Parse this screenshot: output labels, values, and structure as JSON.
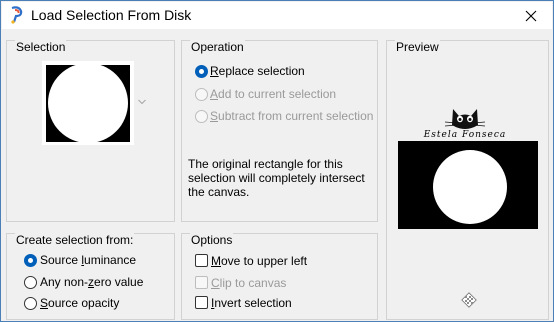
{
  "window": {
    "title": "Load Selection From Disk"
  },
  "selection": {
    "title": "Selection"
  },
  "operation": {
    "title": "Operation",
    "options": [
      {
        "pre": "",
        "ul": "R",
        "post": "eplace selection",
        "checked": true,
        "disabled": false
      },
      {
        "pre": "",
        "ul": "A",
        "post": "dd to current selection",
        "checked": false,
        "disabled": true
      },
      {
        "pre": "",
        "ul": "S",
        "post": "ubtract from current selection",
        "checked": false,
        "disabled": true
      }
    ],
    "description_lines": [
      "The original rectangle for this",
      "selection will completely intersect",
      "the canvas."
    ]
  },
  "preview": {
    "title": "Preview",
    "watermark": "Estela Fonseca"
  },
  "create_from": {
    "title": "Create selection from:",
    "options": [
      {
        "pre": "Source ",
        "ul": "l",
        "post": "uminance",
        "checked": true
      },
      {
        "pre": "Any non-",
        "ul": "z",
        "post": "ero value",
        "checked": false
      },
      {
        "pre": "",
        "ul": "S",
        "post": "ource opacity",
        "checked": false
      }
    ]
  },
  "options": {
    "title": "Options",
    "items": [
      {
        "pre": "",
        "ul": "M",
        "post": "ove to upper left",
        "checked": false,
        "disabled": false
      },
      {
        "pre": "",
        "ul": "C",
        "post": "lip to canvas",
        "checked": false,
        "disabled": true
      },
      {
        "pre": "",
        "ul": "I",
        "post": "nvert selection",
        "checked": false,
        "disabled": false
      }
    ]
  },
  "colors": {
    "accent": "#005fb8",
    "frame": "#4a7fb8"
  }
}
